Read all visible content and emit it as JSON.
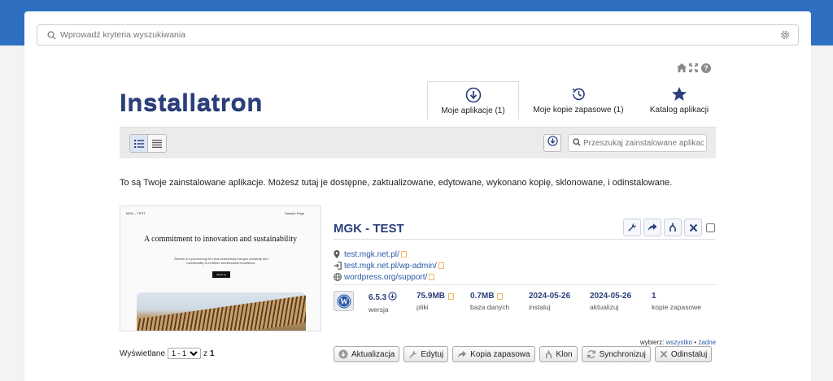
{
  "search": {
    "placeholder": "Wprowadź kryteria wyszukiwania"
  },
  "logo": "Installatron",
  "tabs": [
    {
      "label": "Moje aplikacje (1)",
      "icon": "download-circle-icon",
      "active": true
    },
    {
      "label": "Moje kopie zapasowe (1)",
      "icon": "history-icon",
      "active": false
    },
    {
      "label": "Katalog aplikacji",
      "icon": "star-icon",
      "active": false
    }
  ],
  "toolbar": {
    "search_placeholder": "Przeszukaj zainstalowane aplikacje"
  },
  "description": "To są Twoje zainstalowane aplikacje. Możesz tutaj je dostępne, zaktualizowane, edytowane, wykonano kopię, sklonowane, i odinstalowane.",
  "thumbnail": {
    "site_name": "MGK – TEST",
    "nav": "Sample Page",
    "heading": "A commitment to innovation and sustainability",
    "text": "Études is a pioneering firm that seamlessly merges creativity and functionality to redefine architectural excellence.",
    "button": "About us"
  },
  "app": {
    "title": "MGK - TEST",
    "links": [
      {
        "icon": "location-pin-icon",
        "text": "test.mgk.net.pl/"
      },
      {
        "icon": "login-icon",
        "text": "test.mgk.net.pl/wp-admin/"
      },
      {
        "icon": "globe-icon",
        "text": "wordpress.org/support/"
      }
    ],
    "stats": [
      {
        "value": "6.5.3",
        "label": "wersja"
      },
      {
        "value": "75.9MB",
        "label": "pliki"
      },
      {
        "value": "0.7MB",
        "label": "baza danych"
      },
      {
        "value": "2024-05-26",
        "label": "instaluj"
      },
      {
        "value": "2024-05-26",
        "label": "aktualizuj"
      },
      {
        "value": "1",
        "label": "kopie zapasowe"
      }
    ]
  },
  "select": {
    "prefix": "wybierz:",
    "all": "wszystko",
    "sep": "•",
    "none": "żadne"
  },
  "pager": {
    "label": "Wyświetlane",
    "option": "1 - 1",
    "of": "z",
    "total": "1"
  },
  "buttons": {
    "update": "Aktualizacja",
    "edit": "Edytuj",
    "backup": "Kopia zapasowa",
    "clone": "Klon",
    "sync": "Synchronizuj",
    "uninstall": "Odinstaluj"
  },
  "colors": {
    "accent": "#2a3f7c",
    "topband": "#2f6fc1",
    "link": "#2a5aa8"
  }
}
